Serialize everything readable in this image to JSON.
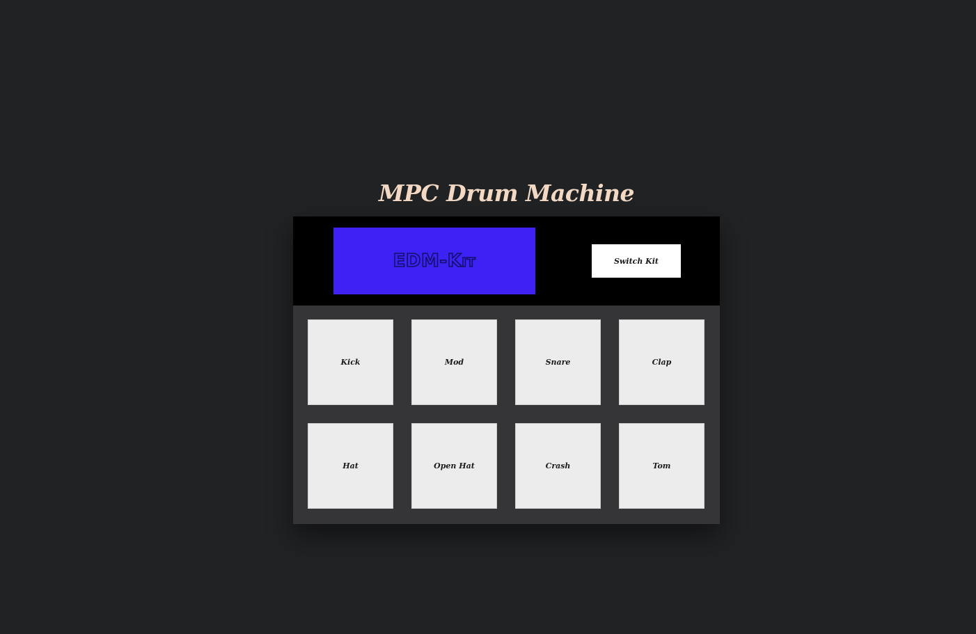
{
  "app": {
    "title": "MPC Drum Machine"
  },
  "display": {
    "kit_name": "EDM-Kit"
  },
  "controls": {
    "switch_kit_label": "Switch Kit"
  },
  "pads": [
    {
      "label": "Kick"
    },
    {
      "label": "Mod"
    },
    {
      "label": "Snare"
    },
    {
      "label": "Clap"
    },
    {
      "label": "Hat"
    },
    {
      "label": "Open Hat"
    },
    {
      "label": "Crash"
    },
    {
      "label": "Tom"
    }
  ],
  "colors": {
    "background": "#212224",
    "title": "#f3d9c4",
    "display": "#3e22f5",
    "pad": "#ececec",
    "pad_panel": "#353537",
    "control_panel": "#000000"
  }
}
